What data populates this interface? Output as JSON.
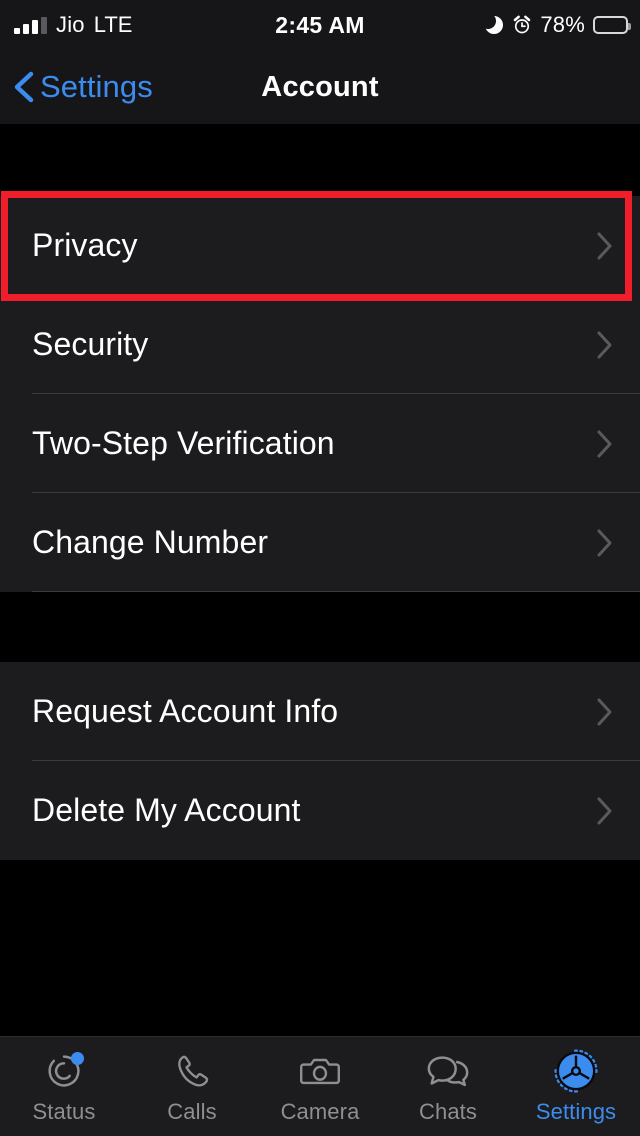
{
  "statusbar": {
    "carrier": "Jio",
    "network": "LTE",
    "time": "2:45 AM",
    "battery_percent": "78%",
    "icons": [
      "signal-bars-icon",
      "moon-icon",
      "alarm-clock-icon",
      "battery-icon"
    ]
  },
  "navbar": {
    "back_label": "Settings",
    "title": "Account",
    "back_icon": "chevron-left-icon",
    "tint_color": "#3c8cf0"
  },
  "groups": [
    {
      "rows": [
        {
          "label": "Privacy",
          "highlighted": true
        },
        {
          "label": "Security",
          "highlighted": false
        },
        {
          "label": "Two-Step Verification",
          "highlighted": false
        },
        {
          "label": "Change Number",
          "highlighted": false
        }
      ]
    },
    {
      "rows": [
        {
          "label": "Request Account Info",
          "highlighted": false
        },
        {
          "label": "Delete My Account",
          "highlighted": false
        }
      ]
    }
  ],
  "highlight": {
    "color": "#ef1e2a",
    "target": "Privacy"
  },
  "tabbar": {
    "items": [
      {
        "label": "Status",
        "icon": "status-rings-icon",
        "active": false,
        "badge": true
      },
      {
        "label": "Calls",
        "icon": "phone-icon",
        "active": false,
        "badge": false
      },
      {
        "label": "Camera",
        "icon": "camera-icon",
        "active": false,
        "badge": false
      },
      {
        "label": "Chats",
        "icon": "chat-bubbles-icon",
        "active": false,
        "badge": false
      },
      {
        "label": "Settings",
        "icon": "gear-icon",
        "active": true,
        "badge": false
      }
    ],
    "active_color": "#3c8cf0",
    "inactive_color": "#8e8e93"
  }
}
